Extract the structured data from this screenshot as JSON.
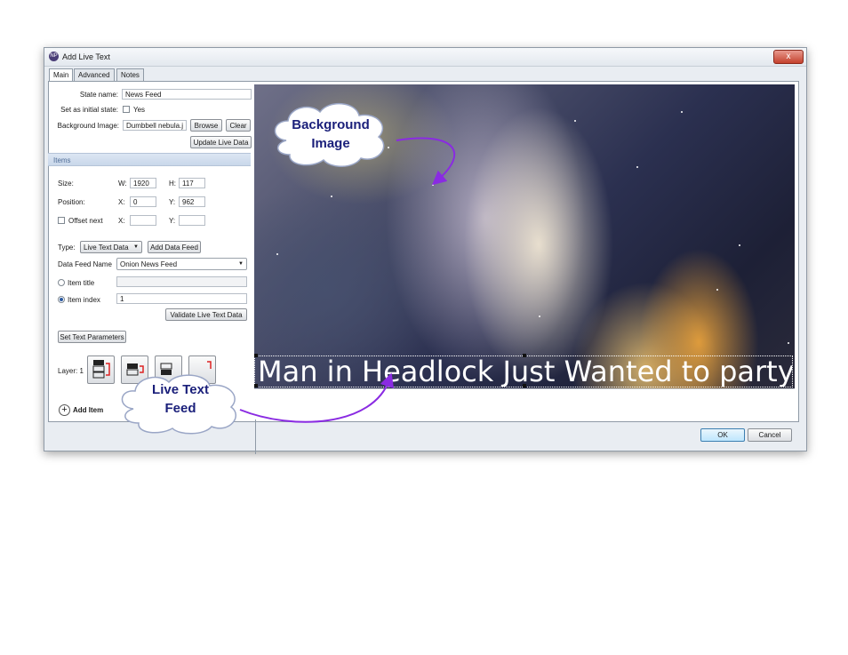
{
  "window": {
    "title": "Add Live Text",
    "app_icon": "add-live-text-icon",
    "close_glyph": "x"
  },
  "tabs": [
    {
      "label": "Main"
    },
    {
      "label": "Advanced"
    },
    {
      "label": "Notes"
    }
  ],
  "main": {
    "state_name_label": "State name:",
    "state_name_value": "News Feed",
    "initial_state_label": "Set as initial state:",
    "initial_state_option": "Yes",
    "background_image_label": "Background Image:",
    "background_image_value": "Dumbbell nebula.j",
    "browse_label": "Browse",
    "clear_label": "Clear",
    "update_live_data_label": "Update Live Data",
    "items_header": "Items",
    "size_label": "Size:",
    "w_label": "W:",
    "w_value": "1920",
    "h_label": "H:",
    "h_value": "117",
    "position_label": "Position:",
    "x_label": "X:",
    "x_value": "0",
    "y_label": "Y:",
    "y_value": "962",
    "offset_next_label": "Offset next",
    "offset_x_label": "X:",
    "offset_y_label": "Y:",
    "type_label": "Type:",
    "type_value": "Live Text Data",
    "add_data_feed_label": "Add Data Feed",
    "data_feed_name_label": "Data Feed Name",
    "data_feed_name_value": "Onion News Feed",
    "item_title_label": "Item title",
    "item_index_label": "Item index",
    "item_index_value": "1",
    "validate_label": "Validate Live Text Data",
    "set_text_params_label": "Set Text Parameters",
    "layer_label": "Layer: 1",
    "add_item_label": "Add Item"
  },
  "preview": {
    "live_text": "Man in Headlock Just Wanted to party"
  },
  "callouts": {
    "background": {
      "line1": "Background",
      "line2": "Image"
    },
    "live_feed": {
      "line1": "Live Text",
      "line2": "Feed"
    }
  },
  "footer": {
    "ok_label": "OK",
    "cancel_label": "Cancel"
  },
  "colors": {
    "callout_text": "#1a1f7a",
    "arrow": "#8a2be2",
    "accent": "#4f6d97"
  }
}
